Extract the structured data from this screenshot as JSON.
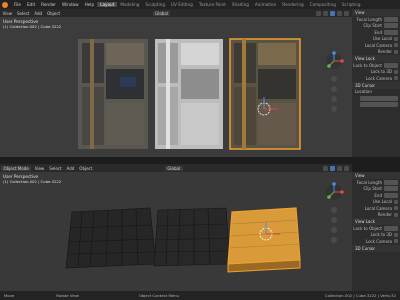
{
  "menu": {
    "file": "File",
    "edit": "Edit",
    "render": "Render",
    "window": "Window",
    "help": "Help"
  },
  "tabs": [
    "Layout",
    "Modeling",
    "Sculpting",
    "UV Editing",
    "Texture Paint",
    "Shading",
    "Animation",
    "Rendering",
    "Compositing",
    "Scripting"
  ],
  "top_view": {
    "header": {
      "view": "View",
      "select": "Select",
      "add": "Add",
      "object": "Object",
      "orientation": "Global"
    },
    "overlay_title": "User Perspective",
    "overlay_sub": "(1) Collection.002 | Cube.3222"
  },
  "bottom_view": {
    "header": {
      "mode": "Object Mode",
      "view": "View",
      "select": "Select",
      "add": "Add",
      "object": "Object",
      "orientation": "Global"
    },
    "overlay_title": "User Perspective",
    "overlay_sub": "(1) Collection.002 | Cube.3222"
  },
  "sidebar_top": {
    "view_section": "View",
    "focal_length": "Focal Length",
    "clip_start": "Clip Start",
    "clip_end": "End",
    "use_local": "Use Local",
    "local_camera": "Local Camera",
    "render_region": "Render",
    "view_lock": "View Lock",
    "lock_to_object": "Lock to Object",
    "lock_to_3d": "Lock to 3D",
    "lock_camera": "Lock Camera",
    "cursor_section": "3D Cursor",
    "location": "Location"
  },
  "sidebar_bottom": {
    "view_section": "View",
    "focal_length": "Focal Length",
    "clip_start": "Clip Start",
    "clip_end": "End",
    "use_local": "Use Local",
    "local_camera": "Local Camera",
    "render_region": "Render",
    "view_lock": "View Lock",
    "lock_to_object": "Lock to Object",
    "lock_to_3d": "Lock to 3D",
    "lock_camera": "Lock Camera",
    "cursor_section": "3D Cursor"
  },
  "status": {
    "select": "Move",
    "rotate": "Rotate View",
    "context": "Object Context Menu",
    "stats": "Collection.002 | Cube.3222 | Verts:32"
  },
  "colors": {
    "accent": "#4772b3",
    "selected": "#f0a030",
    "blender": "#e8822b"
  }
}
